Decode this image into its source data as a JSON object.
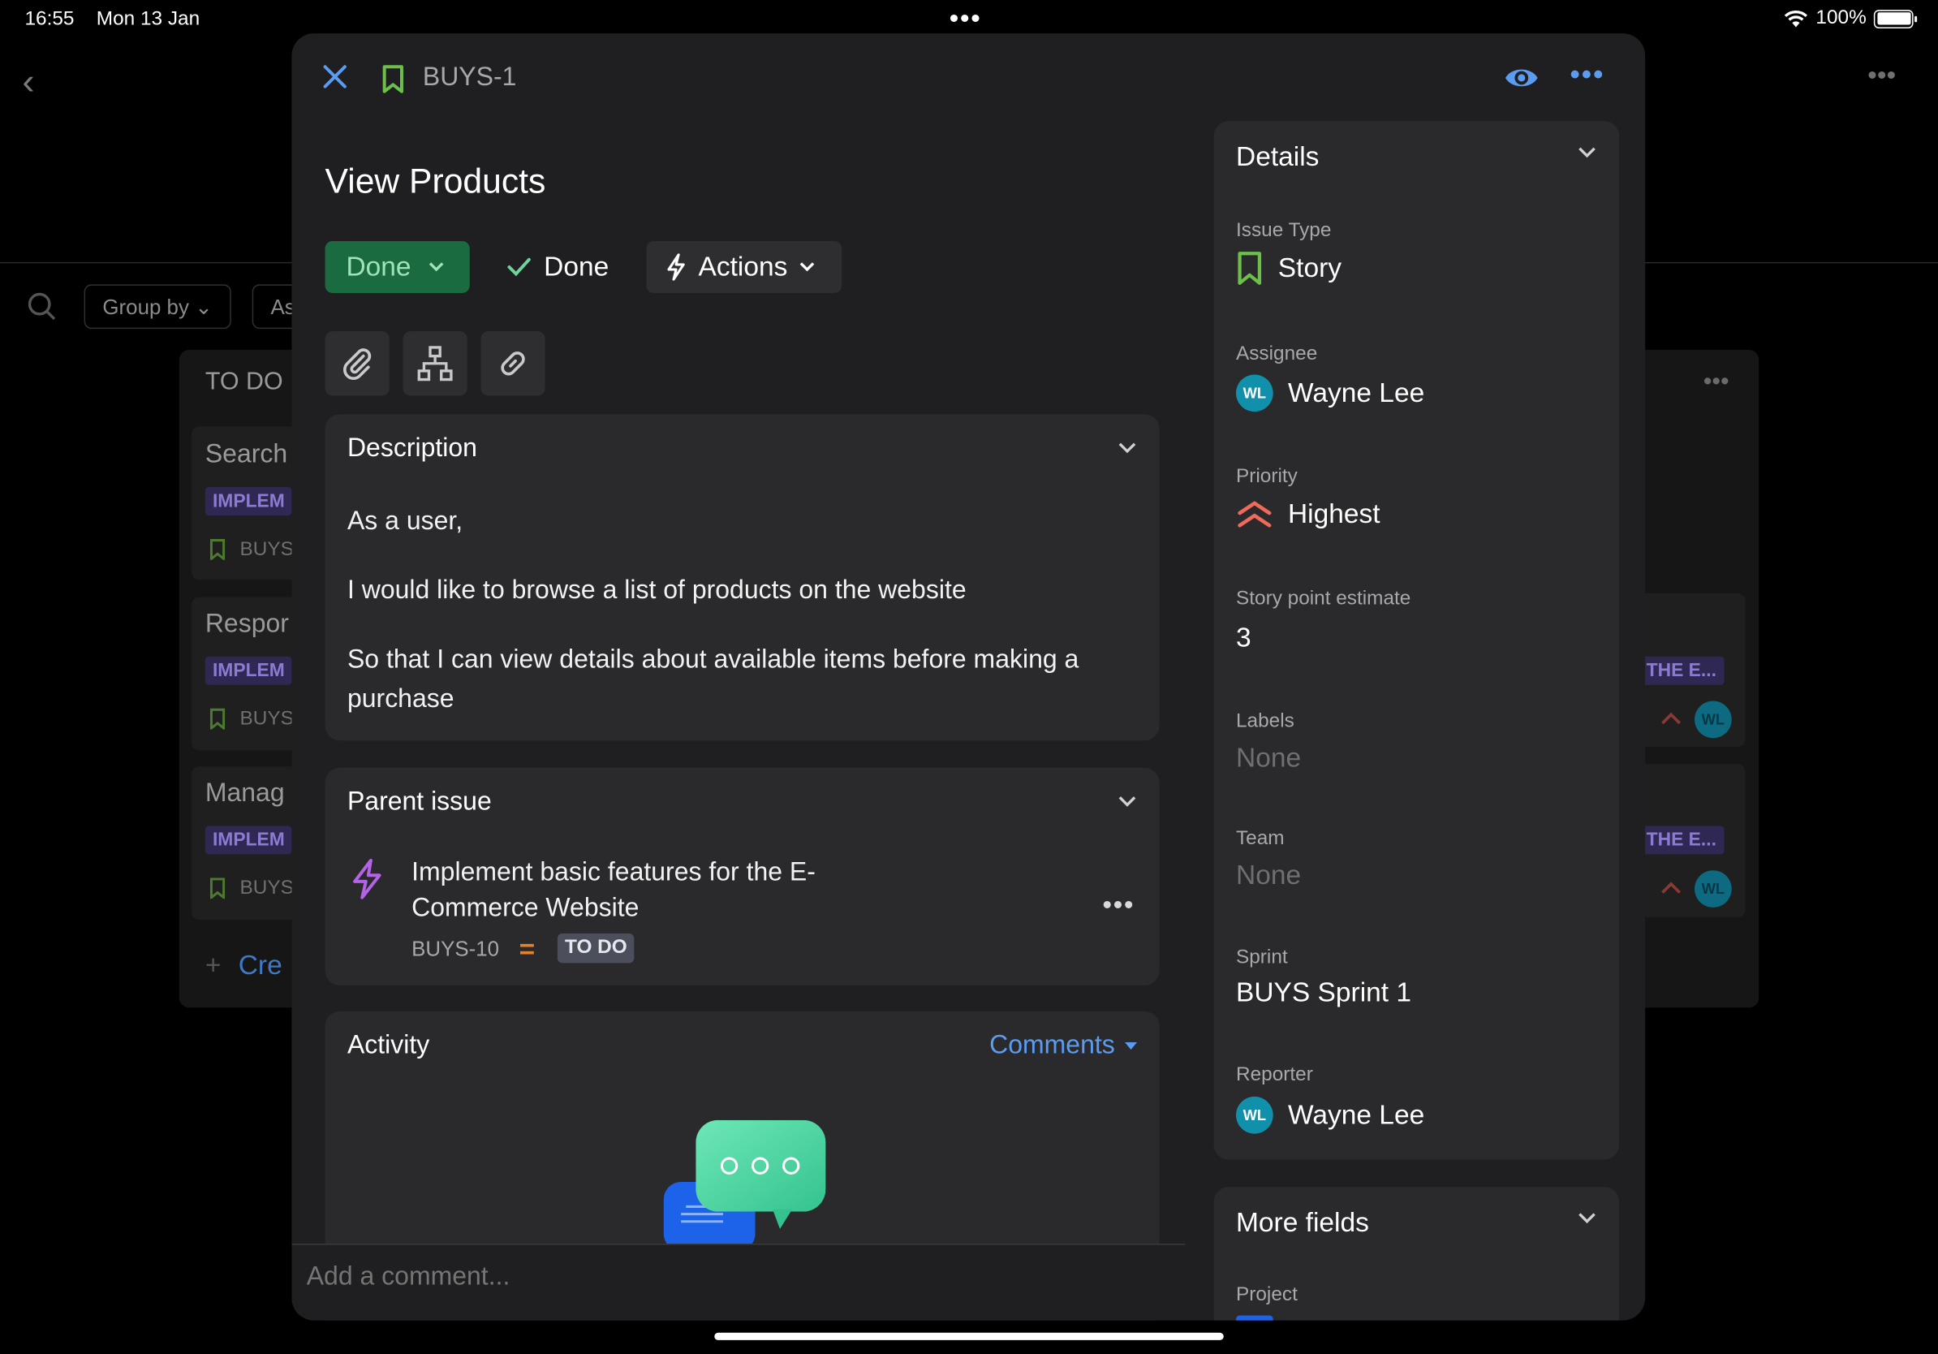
{
  "status_bar": {
    "time": "16:55",
    "date": "Mon 13 Jan",
    "battery": "100%"
  },
  "background": {
    "group_by": "Group by",
    "chip2": "As",
    "column_title": "TO DO",
    "cards": [
      {
        "title": "Search",
        "epic": "IMPLEM",
        "key": "BUYS"
      },
      {
        "title": "Respor",
        "epic": "IMPLEM",
        "key": "BUYS",
        "right_epic": "THE E...",
        "right_avatar": "WL"
      },
      {
        "title": "Manag",
        "epic": "IMPLEM",
        "key": "BUYS",
        "right_epic": "THE E...",
        "right_avatar": "WL"
      }
    ],
    "create": "Cre"
  },
  "issue": {
    "key": "BUYS-1",
    "title": "View Products",
    "status_button": "Done",
    "resolution": "Done",
    "actions": "Actions"
  },
  "description": {
    "heading": "Description",
    "paragraphs": [
      "As a user,",
      "I would like to browse a list of products on the website",
      "So that I can view details about available items before making a purchase"
    ]
  },
  "parent": {
    "heading": "Parent issue",
    "title": "Implement basic features for the E-Commerce Website",
    "key": "BUYS-10",
    "priority_symbol": "=",
    "status": "TO DO"
  },
  "activity": {
    "heading": "Activity",
    "filter": "Comments",
    "comment_placeholder": "Add a comment..."
  },
  "details": {
    "heading": "Details",
    "fields": {
      "issue_type": {
        "label": "Issue Type",
        "value": "Story"
      },
      "assignee": {
        "label": "Assignee",
        "value": "Wayne Lee",
        "initials": "WL"
      },
      "priority": {
        "label": "Priority",
        "value": "Highest"
      },
      "story_points": {
        "label": "Story point estimate",
        "value": "3"
      },
      "labels": {
        "label": "Labels",
        "value": "None"
      },
      "team": {
        "label": "Team",
        "value": "None"
      },
      "sprint": {
        "label": "Sprint",
        "value": "BUYS Sprint 1"
      },
      "reporter": {
        "label": "Reporter",
        "value": "Wayne Lee",
        "initials": "WL"
      }
    }
  },
  "more_fields": {
    "heading": "More fields",
    "project_label": "Project"
  },
  "colors": {
    "accent": "#5b9cf1",
    "done_bg": "#1b6b40",
    "done_text": "#9fe4b6",
    "story_green": "#6cc04a",
    "priority_red": "#f06a5a",
    "epic_purple": "#b463e8"
  }
}
